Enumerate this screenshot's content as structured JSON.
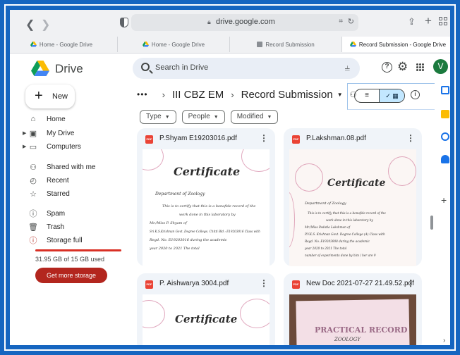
{
  "browser": {
    "url": "drive.google.com",
    "tabs": [
      {
        "label": "Home - Google Drive",
        "icon": "drive-icon",
        "active": false
      },
      {
        "label": "Home - Google Drive",
        "icon": "drive-icon",
        "active": false
      },
      {
        "label": "Record Submission",
        "icon": "folder-icon",
        "active": false
      },
      {
        "label": "Record Submission - Google Drive",
        "icon": "drive-icon",
        "active": true
      }
    ]
  },
  "header": {
    "app_name": "Drive",
    "search_placeholder": "Search in Drive",
    "avatar_initial": "V"
  },
  "sidebar": {
    "new_label": "New",
    "items": [
      {
        "label": "Home",
        "icon": "home-icon"
      },
      {
        "label": "My Drive",
        "icon": "my-drive-icon"
      },
      {
        "label": "Computers",
        "icon": "computer-icon"
      },
      {
        "label": "Shared with me",
        "icon": "people-icon"
      },
      {
        "label": "Recent",
        "icon": "clock-icon"
      },
      {
        "label": "Starred",
        "icon": "star-icon"
      },
      {
        "label": "Spam",
        "icon": "spam-icon"
      },
      {
        "label": "Trash",
        "icon": "trash-icon"
      },
      {
        "label": "Storage full",
        "icon": "storage-warning-icon"
      }
    ],
    "storage_text": "31.95 GB of 15 GB used",
    "storage_fraction": 1.0,
    "get_storage_label": "Get more storage",
    "storage_color": "#d93025"
  },
  "breadcrumb": {
    "ellipsis": "•••",
    "parent": "III CBZ EM",
    "current": "Record Submission"
  },
  "filters": [
    "Type",
    "People",
    "Modified"
  ],
  "files": [
    {
      "name": "P.Shyam E19203016.pdf",
      "thumb": {
        "title": "Certificate",
        "dept": "Department of   Zoology",
        "lines": [
          "This is to certify that this is a bonafide record of the",
          "work done in this laboratory by",
          "Mr./Miss     P. Shyam                                    of",
          "Sri K.S.Krishnan Govt. Degree College, Chitti Bld : E19203016 Class with",
          "Regd. No.   E19203016             during the academic",
          "year   2020     to     2021                          The total"
        ]
      }
    },
    {
      "name": "P.Lakshman.08.pdf",
      "thumb": {
        "title": "Certificate",
        "dept": "Department of     Zoology",
        "lines": [
          "This is to certify that this is a bonafide record of the",
          "work done in this laboratory by",
          "Mr./Miss     Pedatla Lakshman                          of",
          "P.V.K.S. Krishnan Govt. Degree College (A)  Class with",
          "Regd. No.    E19203008          during the academic",
          "year    2020        to      2021               The total",
          "number of experiments done by him / her are    9"
        ]
      }
    },
    {
      "name": "P. Aishwarya 3004.pdf",
      "thumb": {
        "title": "Certificate"
      }
    },
    {
      "name": "New Doc 2021-07-27 21.49.52.pdf",
      "thumb": {
        "title": "PRACTICAL RECORD",
        "subtitle": "ZOOLOGY"
      }
    }
  ],
  "colors": {
    "accent": "#0b57d0",
    "toggle_selected": "#c2e7ff",
    "danger": "#b3261e",
    "pdf": "#ea4335",
    "avatar": "#1b7a3e",
    "frame": "#1565c0"
  }
}
